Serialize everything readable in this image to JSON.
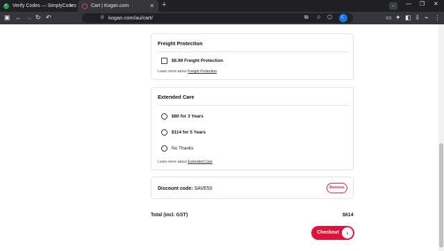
{
  "browser": {
    "tabs": [
      {
        "title": "Verify Codes — SimplyCodes",
        "close": "✕"
      },
      {
        "title": "Cart | Kogan.com",
        "close": "✕"
      }
    ],
    "new_tab": "+",
    "tab_dropdown": "⌄",
    "window_controls": {
      "minimize": "—",
      "restore": "❐",
      "close": "✕"
    },
    "address": "kogan.com/au/cart/"
  },
  "freight": {
    "title": "Freight Protection",
    "option": "$6.99 Freight Protection",
    "learn_prefix": "Learn more about ",
    "learn_link": "Freight Protection"
  },
  "extended": {
    "title": "Extended Care",
    "options": [
      "$80 for 3 Years",
      "$114 for 5 Years",
      "No Thanks"
    ],
    "learn_prefix": "Learn more about ",
    "learn_link": "Extended Care"
  },
  "discount": {
    "label": "Discount code:",
    "code": "SAVE50",
    "remove": "Remove"
  },
  "total": {
    "label": "Total (incl. GST)",
    "value": "$614"
  },
  "checkout": {
    "label": "Checkout",
    "arrow": "›"
  },
  "colors": {
    "brand_red": "#dc143c",
    "chrome_dark": "#202124"
  }
}
